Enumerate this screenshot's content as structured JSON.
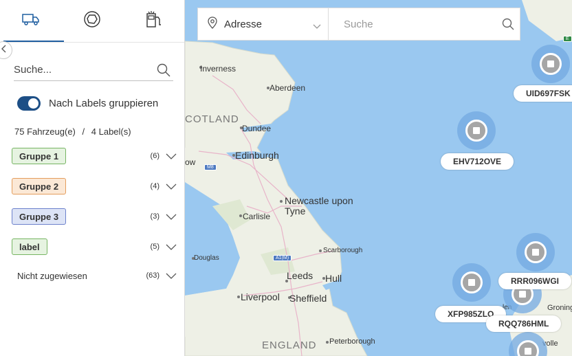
{
  "sidebar": {
    "tabs": [
      {
        "icon": "truck-icon"
      },
      {
        "icon": "geofence-icon"
      },
      {
        "icon": "fuel-station-icon"
      }
    ],
    "search_placeholder": "Suche...",
    "toggle_label": "Nach Labels gruppieren",
    "toggle_on": true,
    "vehicle_count": "75 Fahrzeug(e)",
    "separator": "/",
    "label_count": "4 Label(s)",
    "groups": [
      {
        "label": "Gruppe 1",
        "count": "(6)",
        "color": "#76b562"
      },
      {
        "label": "Gruppe 2",
        "count": "(4)",
        "color": "#e49d5c"
      },
      {
        "label": "Gruppe 3",
        "count": "(3)",
        "color": "#6c81cc"
      },
      {
        "label": "label",
        "count": "(5)",
        "color": "#76b562"
      },
      {
        "label": "Nicht zugewiesen",
        "count": "(63)",
        "color": null
      }
    ]
  },
  "map_search": {
    "address_label": "Adresse",
    "search_placeholder": "Suche"
  },
  "map": {
    "places": [
      "Inverness",
      "Aberdeen",
      "Dundee",
      "Edinburgh",
      "Newcastle upon",
      "Tyne",
      "Carlisle",
      "Scarborough",
      "Douglas",
      "Leeds",
      "Hull",
      "Liverpool",
      "Sheffield",
      "Peterborough",
      "len",
      "Groning",
      "volle",
      "ow"
    ],
    "regions": [
      "COTLAND",
      "ENGLAND"
    ],
    "roads": [
      "M8",
      "A1(M)",
      "E"
    ],
    "vehicles": [
      "UID697FSK",
      "EHV712OVE",
      "RRR096WGI",
      "XFP985ZLO",
      "RQQ786HML"
    ]
  }
}
